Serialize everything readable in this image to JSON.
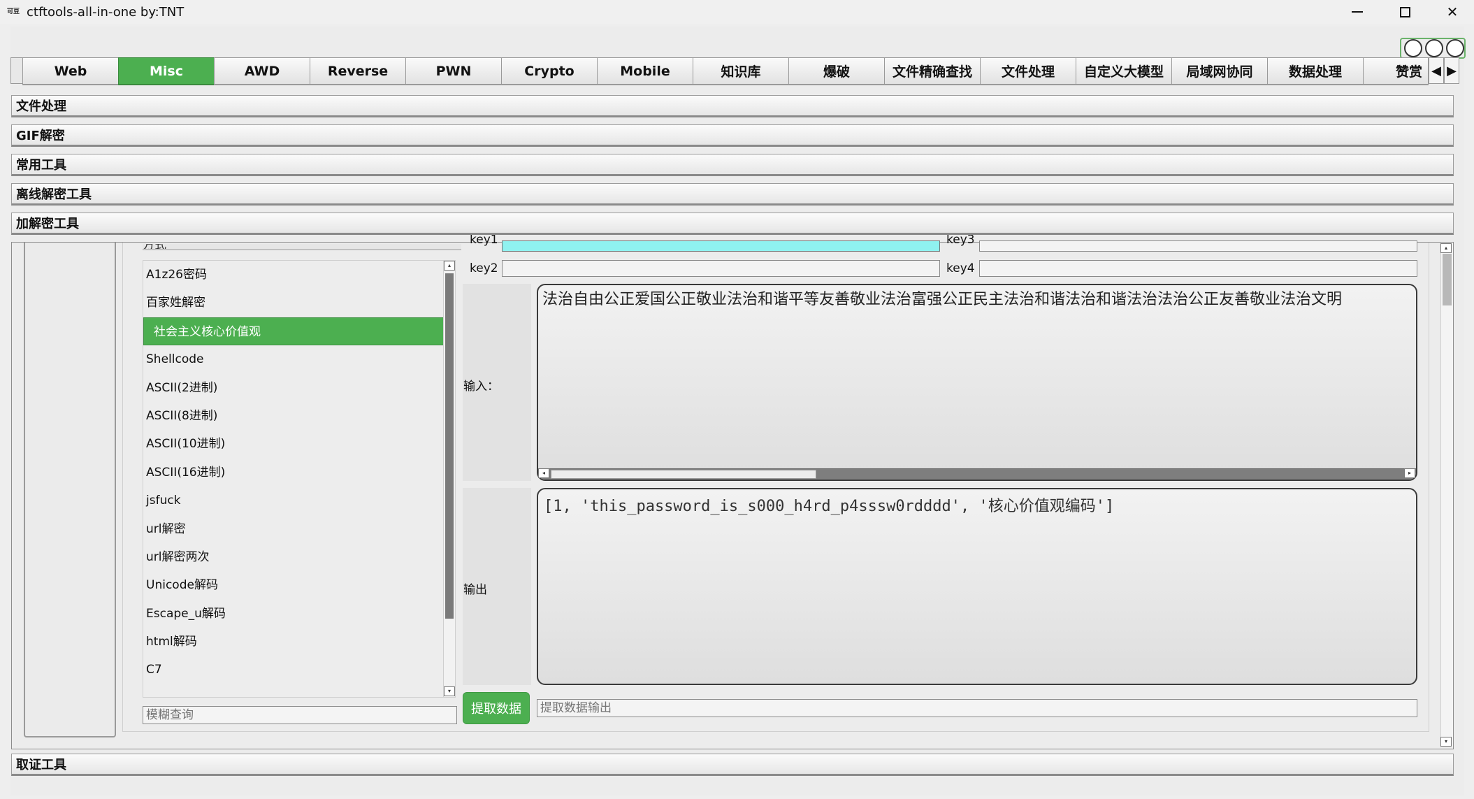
{
  "window": {
    "icon_text": "可豆",
    "title": "ctftools-all-in-one   by:TNT",
    "minimize": "—",
    "close": "✕"
  },
  "tabs": [
    {
      "label": "Web",
      "active": false
    },
    {
      "label": "Misc",
      "active": true
    },
    {
      "label": "AWD",
      "active": false
    },
    {
      "label": "Reverse",
      "active": false
    },
    {
      "label": "PWN",
      "active": false
    },
    {
      "label": "Crypto",
      "active": false
    },
    {
      "label": "Mobile",
      "active": false
    },
    {
      "label": "知识库",
      "active": false
    },
    {
      "label": "爆破",
      "active": false
    },
    {
      "label": "文件精确查找",
      "active": false
    },
    {
      "label": "文件处理",
      "active": false
    },
    {
      "label": "自定义大模型",
      "active": false
    },
    {
      "label": "局域网协同",
      "active": false
    },
    {
      "label": "数据处理",
      "active": false
    },
    {
      "label": "赞赏",
      "active": false
    }
  ],
  "tab_scroll": {
    "left": "◀",
    "right": "▶"
  },
  "sections": {
    "file_processing": "文件处理",
    "gif_decrypt": "GIF解密",
    "common_tools": "常用工具",
    "offline_decrypt": "离线解密工具",
    "encrypt_decrypt": "加解密工具",
    "forensics": "取证工具"
  },
  "crypto_panel": {
    "method_label": "方式",
    "methods": [
      "A1z26密码",
      "百家姓解密",
      "社会主义核心价值观",
      "Shellcode",
      "ASCII(2进制)",
      "ASCII(8进制)",
      "ASCII(10进制)",
      "ASCII(16进制)",
      "jsfuck",
      "url解密",
      "url解密两次",
      "Unicode解码",
      "Escape_u解码",
      "html解码",
      "C7"
    ],
    "selected_method": "社会主义核心价值观",
    "search_placeholder": "模糊查询",
    "key1_label": "key1",
    "key2_label": "key2",
    "key3_label": "key3",
    "key4_label": "key4",
    "input_label": "输入：",
    "input_value": "法治自由公正爱国公正敬业法治和谐平等友善敬业法治富强公正民主法治和谐法治和谐法治法治公正友善敬业法治文明",
    "output_label": "输出",
    "output_value": "[1, 'this_password_is_s000_h4rd_p4sssw0rdddd', '核心价值观编码']",
    "extract_button": "提取数据",
    "extract_placeholder": "提取数据输出",
    "scroll_up": "▴",
    "scroll_down": "▾",
    "scroll_left": "◂",
    "scroll_right": "▸"
  },
  "colors": {
    "accent_green": "#4caf50",
    "key1_highlight": "#8ff2f0"
  }
}
